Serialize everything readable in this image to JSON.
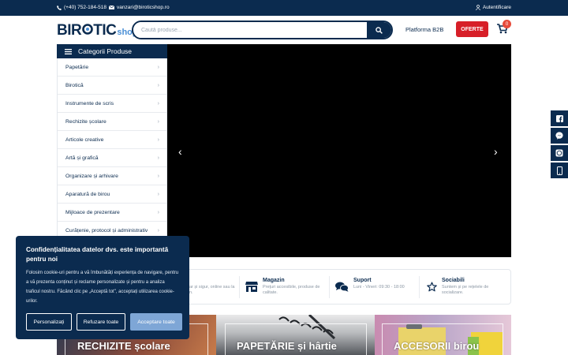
{
  "topbar": {
    "phone": "(+40) 752-184-518",
    "email": "vanzari@biroticshop.ro",
    "auth_label": "Autentificare"
  },
  "header": {
    "logo_text_a": "BIR",
    "logo_text_b": "TIC",
    "logo_shop": "shop",
    "search_placeholder": "Caută produse...",
    "b2b_label": "Platforma B2B",
    "offers_label": "OFERTE",
    "cart_count": "0"
  },
  "categories": {
    "title": "Categorii Produse",
    "items": [
      "Papetărie",
      "Birotică",
      "Instrumente de scris",
      "Rechizite școlare",
      "Articole creative",
      "Artă și grafică",
      "Organizare și arhivare",
      "Aparatură de birou",
      "Mijloace de prezentare",
      "Curățenie, protocol și administrativ"
    ]
  },
  "features": {
    "fragment_line1": "ar și sigur, online sau la",
    "fragment_line2": "n.",
    "items": [
      {
        "title": "Magazin",
        "desc1": "Prețuri accesibile, produse de",
        "desc2": "calitate."
      },
      {
        "title": "Suport",
        "desc1": "Luni - Vineri: 09:30 - 18:00",
        "desc2": ""
      },
      {
        "title": "Sociabili",
        "desc1": "Suntem și pe rețelele de",
        "desc2": "socializare."
      }
    ]
  },
  "banners": [
    {
      "label": "RECHIZITE școlare"
    },
    {
      "label": "PAPETĂRIE și hârtie"
    },
    {
      "label": "ACCESORII birou"
    }
  ],
  "cookie": {
    "title": "Confidențialitatea datelor dvs. este importantă pentru noi",
    "text": "Folosim cookie-uri pentru a vă îmbunătăți experiența de navigare, pentru a vă prezenta conținut și reclame personalizate și pentru a analiza traficul nostru. Făcând clic pe „Acceptă tot\", acceptați utilizarea cookie-urilor.",
    "customize_label": "Personalizați",
    "reject_label": "Refuzare toate",
    "accept_label": "Acceptare toate"
  },
  "social_icons": [
    "facebook-icon",
    "messenger-icon",
    "whatsapp-icon",
    "phone-icon"
  ],
  "colors": {
    "brand": "#0b2b4f",
    "offers": "#d71f28",
    "accept": "#7ea6d6"
  }
}
